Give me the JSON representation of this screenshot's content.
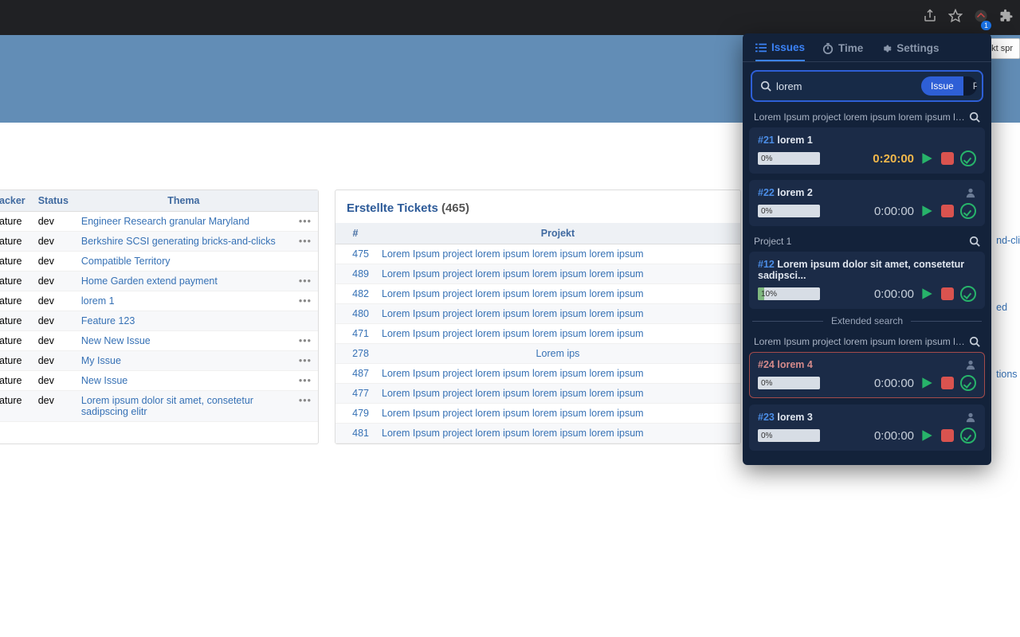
{
  "browser": {
    "ext_badge_count": "1"
  },
  "context_button": "n Kont\nekt spr",
  "left_panel": {
    "headers": {
      "tracker": "acker",
      "status": "Status",
      "thema": "Thema"
    },
    "rows": [
      {
        "tracker": "ature",
        "status": "dev",
        "thema": "Engineer Research granular Maryland",
        "dots": true
      },
      {
        "tracker": "ature",
        "status": "dev",
        "thema": "Berkshire SCSI generating bricks-and-clicks",
        "dots": true
      },
      {
        "tracker": "ature",
        "status": "dev",
        "thema": "Compatible Territory",
        "dots": false
      },
      {
        "tracker": "ature",
        "status": "dev",
        "thema": "Home Garden extend payment",
        "dots": true
      },
      {
        "tracker": "ature",
        "status": "dev",
        "thema": "lorem 1",
        "dots": true
      },
      {
        "tracker": "ature",
        "status": "dev",
        "thema": "Feature 123",
        "dots": false
      },
      {
        "tracker": "ature",
        "status": "dev",
        "thema": "New New Issue",
        "dots": true
      },
      {
        "tracker": "ature",
        "status": "dev",
        "thema": "My Issue",
        "dots": true
      },
      {
        "tracker": "ature",
        "status": "dev",
        "thema": "New Issue",
        "dots": true
      },
      {
        "tracker": "ature",
        "status": "dev",
        "thema": "Lorem ipsum dolor sit amet, consetetur sadipscing elitr",
        "dots": true
      }
    ]
  },
  "right_panel": {
    "title": "Erstellte Tickets",
    "count": "(465)",
    "headers": {
      "num": "#",
      "projekt": "Projekt"
    },
    "rows": [
      {
        "num": "475",
        "projekt": "Lorem Ipsum project lorem ipsum lorem ipsum lorem ipsum"
      },
      {
        "num": "489",
        "projekt": "Lorem Ipsum project lorem ipsum lorem ipsum lorem ipsum"
      },
      {
        "num": "482",
        "projekt": "Lorem Ipsum project lorem ipsum lorem ipsum lorem ipsum"
      },
      {
        "num": "480",
        "projekt": "Lorem Ipsum project lorem ipsum lorem ipsum lorem ipsum"
      },
      {
        "num": "471",
        "projekt": "Lorem Ipsum project lorem ipsum lorem ipsum lorem ipsum"
      },
      {
        "num": "278",
        "projekt": "Lorem ips"
      },
      {
        "num": "487",
        "projekt": "Lorem Ipsum project lorem ipsum lorem ipsum lorem ipsum"
      },
      {
        "num": "477",
        "projekt": "Lorem Ipsum project lorem ipsum lorem ipsum lorem ipsum"
      },
      {
        "num": "479",
        "projekt": "Lorem Ipsum project lorem ipsum lorem ipsum lorem ipsum"
      },
      {
        "num": "481",
        "projekt": "Lorem Ipsum project lorem ipsum lorem ipsum lorem ipsum"
      }
    ]
  },
  "right_edge": [
    "nd-cli",
    "ed",
    "tions"
  ],
  "ext": {
    "tabs": {
      "issues": "Issues",
      "time": "Time",
      "settings": "Settings"
    },
    "search_value": "lorem",
    "toggle": {
      "issue": "Issue",
      "project": "Project"
    },
    "groups": [
      {
        "label": "Lorem Ipsum project lorem ipsum lorem ipsum lor..."
      },
      {
        "label": "Project 1"
      }
    ],
    "extended_label": "Extended search",
    "group_ext": {
      "label": "Lorem Ipsum project lorem ipsum lorem ipsum lor..."
    },
    "cards": [
      {
        "id": "#21",
        "title": "lorem 1",
        "pct": "0%",
        "pctw": "0",
        "time": "0:20:00",
        "active": true,
        "person": false,
        "red": false
      },
      {
        "id": "#22",
        "title": "lorem 2",
        "pct": "0%",
        "pctw": "0",
        "time": "0:00:00",
        "active": false,
        "person": true,
        "red": false
      },
      {
        "id": "#12",
        "title": "Lorem ipsum dolor sit amet, consetetur sadipsci...",
        "pct": "10%",
        "pctw": "10",
        "time": "0:00:00",
        "active": false,
        "person": false,
        "red": false
      },
      {
        "id": "#24",
        "title": "lorem 4",
        "pct": "0%",
        "pctw": "0",
        "time": "0:00:00",
        "active": false,
        "person": true,
        "red": true
      },
      {
        "id": "#23",
        "title": "lorem 3",
        "pct": "0%",
        "pctw": "0",
        "time": "0:00:00",
        "active": false,
        "person": true,
        "red": false
      }
    ]
  }
}
